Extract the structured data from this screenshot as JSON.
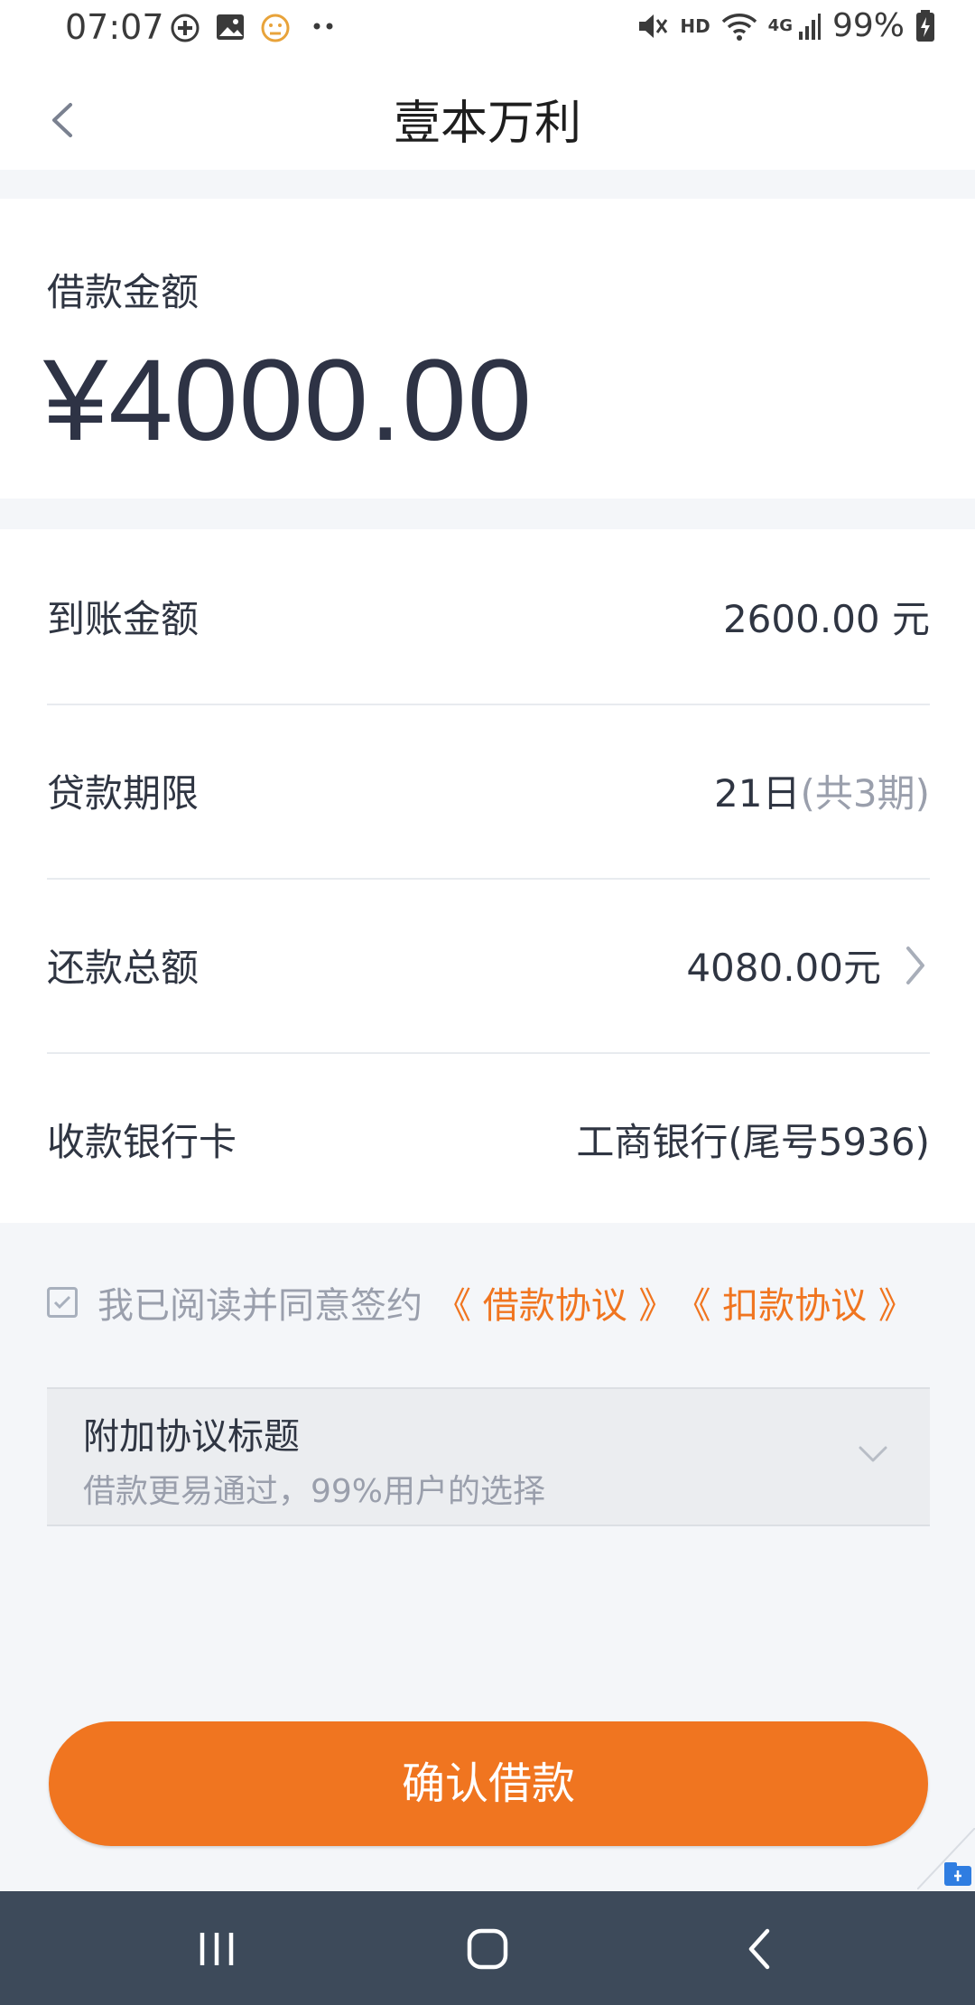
{
  "status_bar": {
    "time": "07:07",
    "network": "HD",
    "signal": "4G",
    "battery": "99%"
  },
  "header": {
    "title": "壹本万利",
    "back_icon": "chevron-left-icon"
  },
  "loan": {
    "amount_label": "借款金额",
    "amount_value": "¥4000.00"
  },
  "details": [
    {
      "label": "到账金额",
      "value": "2600.00 元"
    },
    {
      "label": "贷款期限",
      "value": "21日",
      "value_extra": "(共3期)"
    },
    {
      "label": "还款总额",
      "value": "4080.00元"
    },
    {
      "label": "收款银行卡",
      "value": "工商银行(尾号5936)"
    }
  ],
  "agreement": {
    "checked": true,
    "text": "我已阅读并同意签约",
    "link1": "《 借款协议 》",
    "link2": "《 扣款协议 》"
  },
  "addon": {
    "title": "附加协议标题",
    "subtitle": "借款更易通过，99%用户的选择"
  },
  "confirm_button": "确认借款",
  "colors": {
    "accent": "#f07520",
    "background": "#f4f6f9",
    "navbar": "#3d4a5a"
  }
}
